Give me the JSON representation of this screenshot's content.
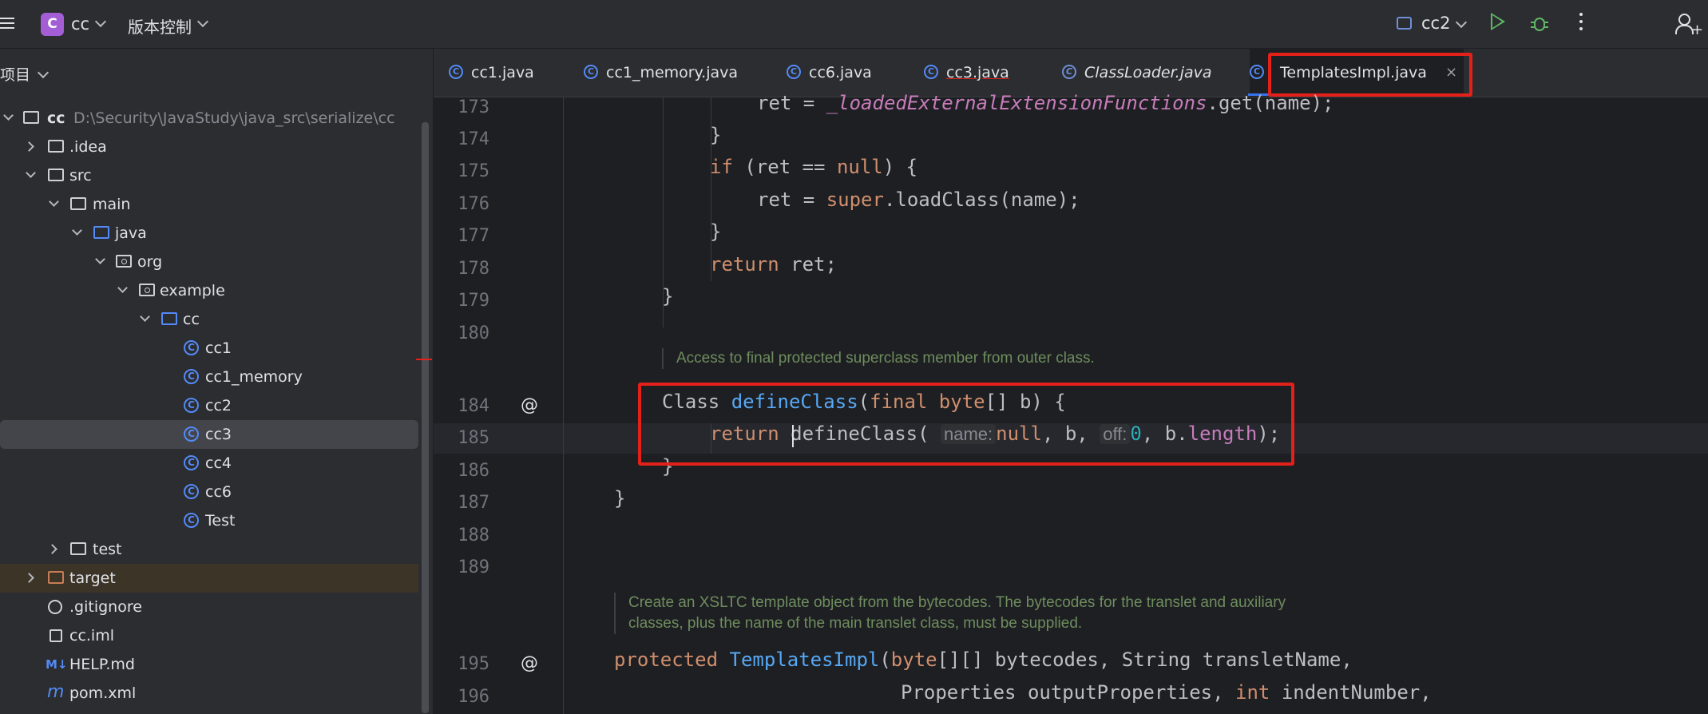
{
  "topbar": {
    "project_badge": "C",
    "project_name": "cc",
    "vcs_label": "版本控制",
    "run_config": "cc2"
  },
  "project_panel": {
    "title": "项目",
    "root": {
      "name": "cc",
      "path": "D:\\Security\\JavaStudy\\java_src\\serialize\\cc"
    },
    "items": [
      {
        "label": ".idea"
      },
      {
        "label": "src"
      },
      {
        "label": "main"
      },
      {
        "label": "java"
      },
      {
        "label": "org"
      },
      {
        "label": "example"
      },
      {
        "label": "cc"
      },
      {
        "label": "cc1"
      },
      {
        "label": "cc1_memory"
      },
      {
        "label": "cc2"
      },
      {
        "label": "cc3"
      },
      {
        "label": "cc4"
      },
      {
        "label": "cc6"
      },
      {
        "label": "Test"
      },
      {
        "label": "test"
      },
      {
        "label": "target"
      },
      {
        "label": ".gitignore"
      },
      {
        "label": "cc.iml"
      },
      {
        "label": "HELP.md"
      },
      {
        "label": "pom.xml"
      }
    ],
    "md_badge": "M↓",
    "pom_badge": "m"
  },
  "tabs": [
    {
      "label": "cc1.java"
    },
    {
      "label": "cc1_memory.java"
    },
    {
      "label": "cc6.java"
    },
    {
      "label": "cc3.java"
    },
    {
      "label": "ClassLoader.java"
    },
    {
      "label": "TemplatesImpl.java"
    }
  ],
  "tab_close": "×",
  "editor": {
    "line_numbers": [
      "173",
      "174",
      "175",
      "176",
      "177",
      "178",
      "179",
      "180",
      "184",
      "185",
      "186",
      "187",
      "188",
      "189",
      "195",
      "196"
    ],
    "doc1": "Access to final protected superclass member from outer class.",
    "doc2_line1": "Create an XSLTC template object from the bytecodes. The bytecodes for the translet and auxiliary",
    "doc2_line2": "classes, plus the name of the main translet class, must be supplied.",
    "gutter_annotation": "@",
    "hint_name": "name:",
    "hint_off": "off:"
  }
}
